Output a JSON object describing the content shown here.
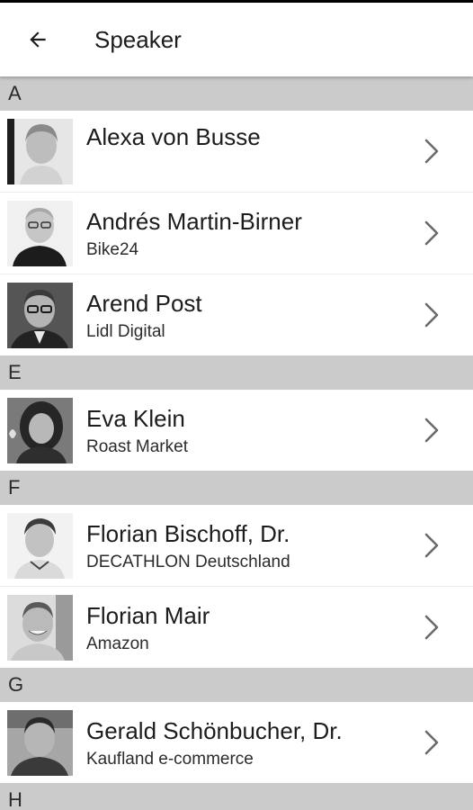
{
  "header": {
    "title": "Speaker",
    "back_icon": "arrow-left-icon"
  },
  "colors": {
    "section_background": "#cbcbcb",
    "row_background": "#ffffff",
    "text": "#1c1c1c"
  },
  "sections": [
    {
      "letter": "A",
      "speakers": [
        {
          "name": "Alexa von Busse",
          "company": ""
        },
        {
          "name": "Andrés Martin-Birner",
          "company": "Bike24"
        },
        {
          "name": "Arend Post",
          "company": "Lidl Digital"
        }
      ]
    },
    {
      "letter": "E",
      "speakers": [
        {
          "name": "Eva Klein",
          "company": "Roast Market"
        }
      ]
    },
    {
      "letter": "F",
      "speakers": [
        {
          "name": "Florian Bischoff, Dr.",
          "company": "DECATHLON Deutschland"
        },
        {
          "name": "Florian Mair",
          "company": "Amazon"
        }
      ]
    },
    {
      "letter": "G",
      "speakers": [
        {
          "name": "Gerald Schönbucher, Dr.",
          "company": "Kaufland e-commerce"
        }
      ]
    },
    {
      "letter": "H",
      "speakers": []
    }
  ]
}
